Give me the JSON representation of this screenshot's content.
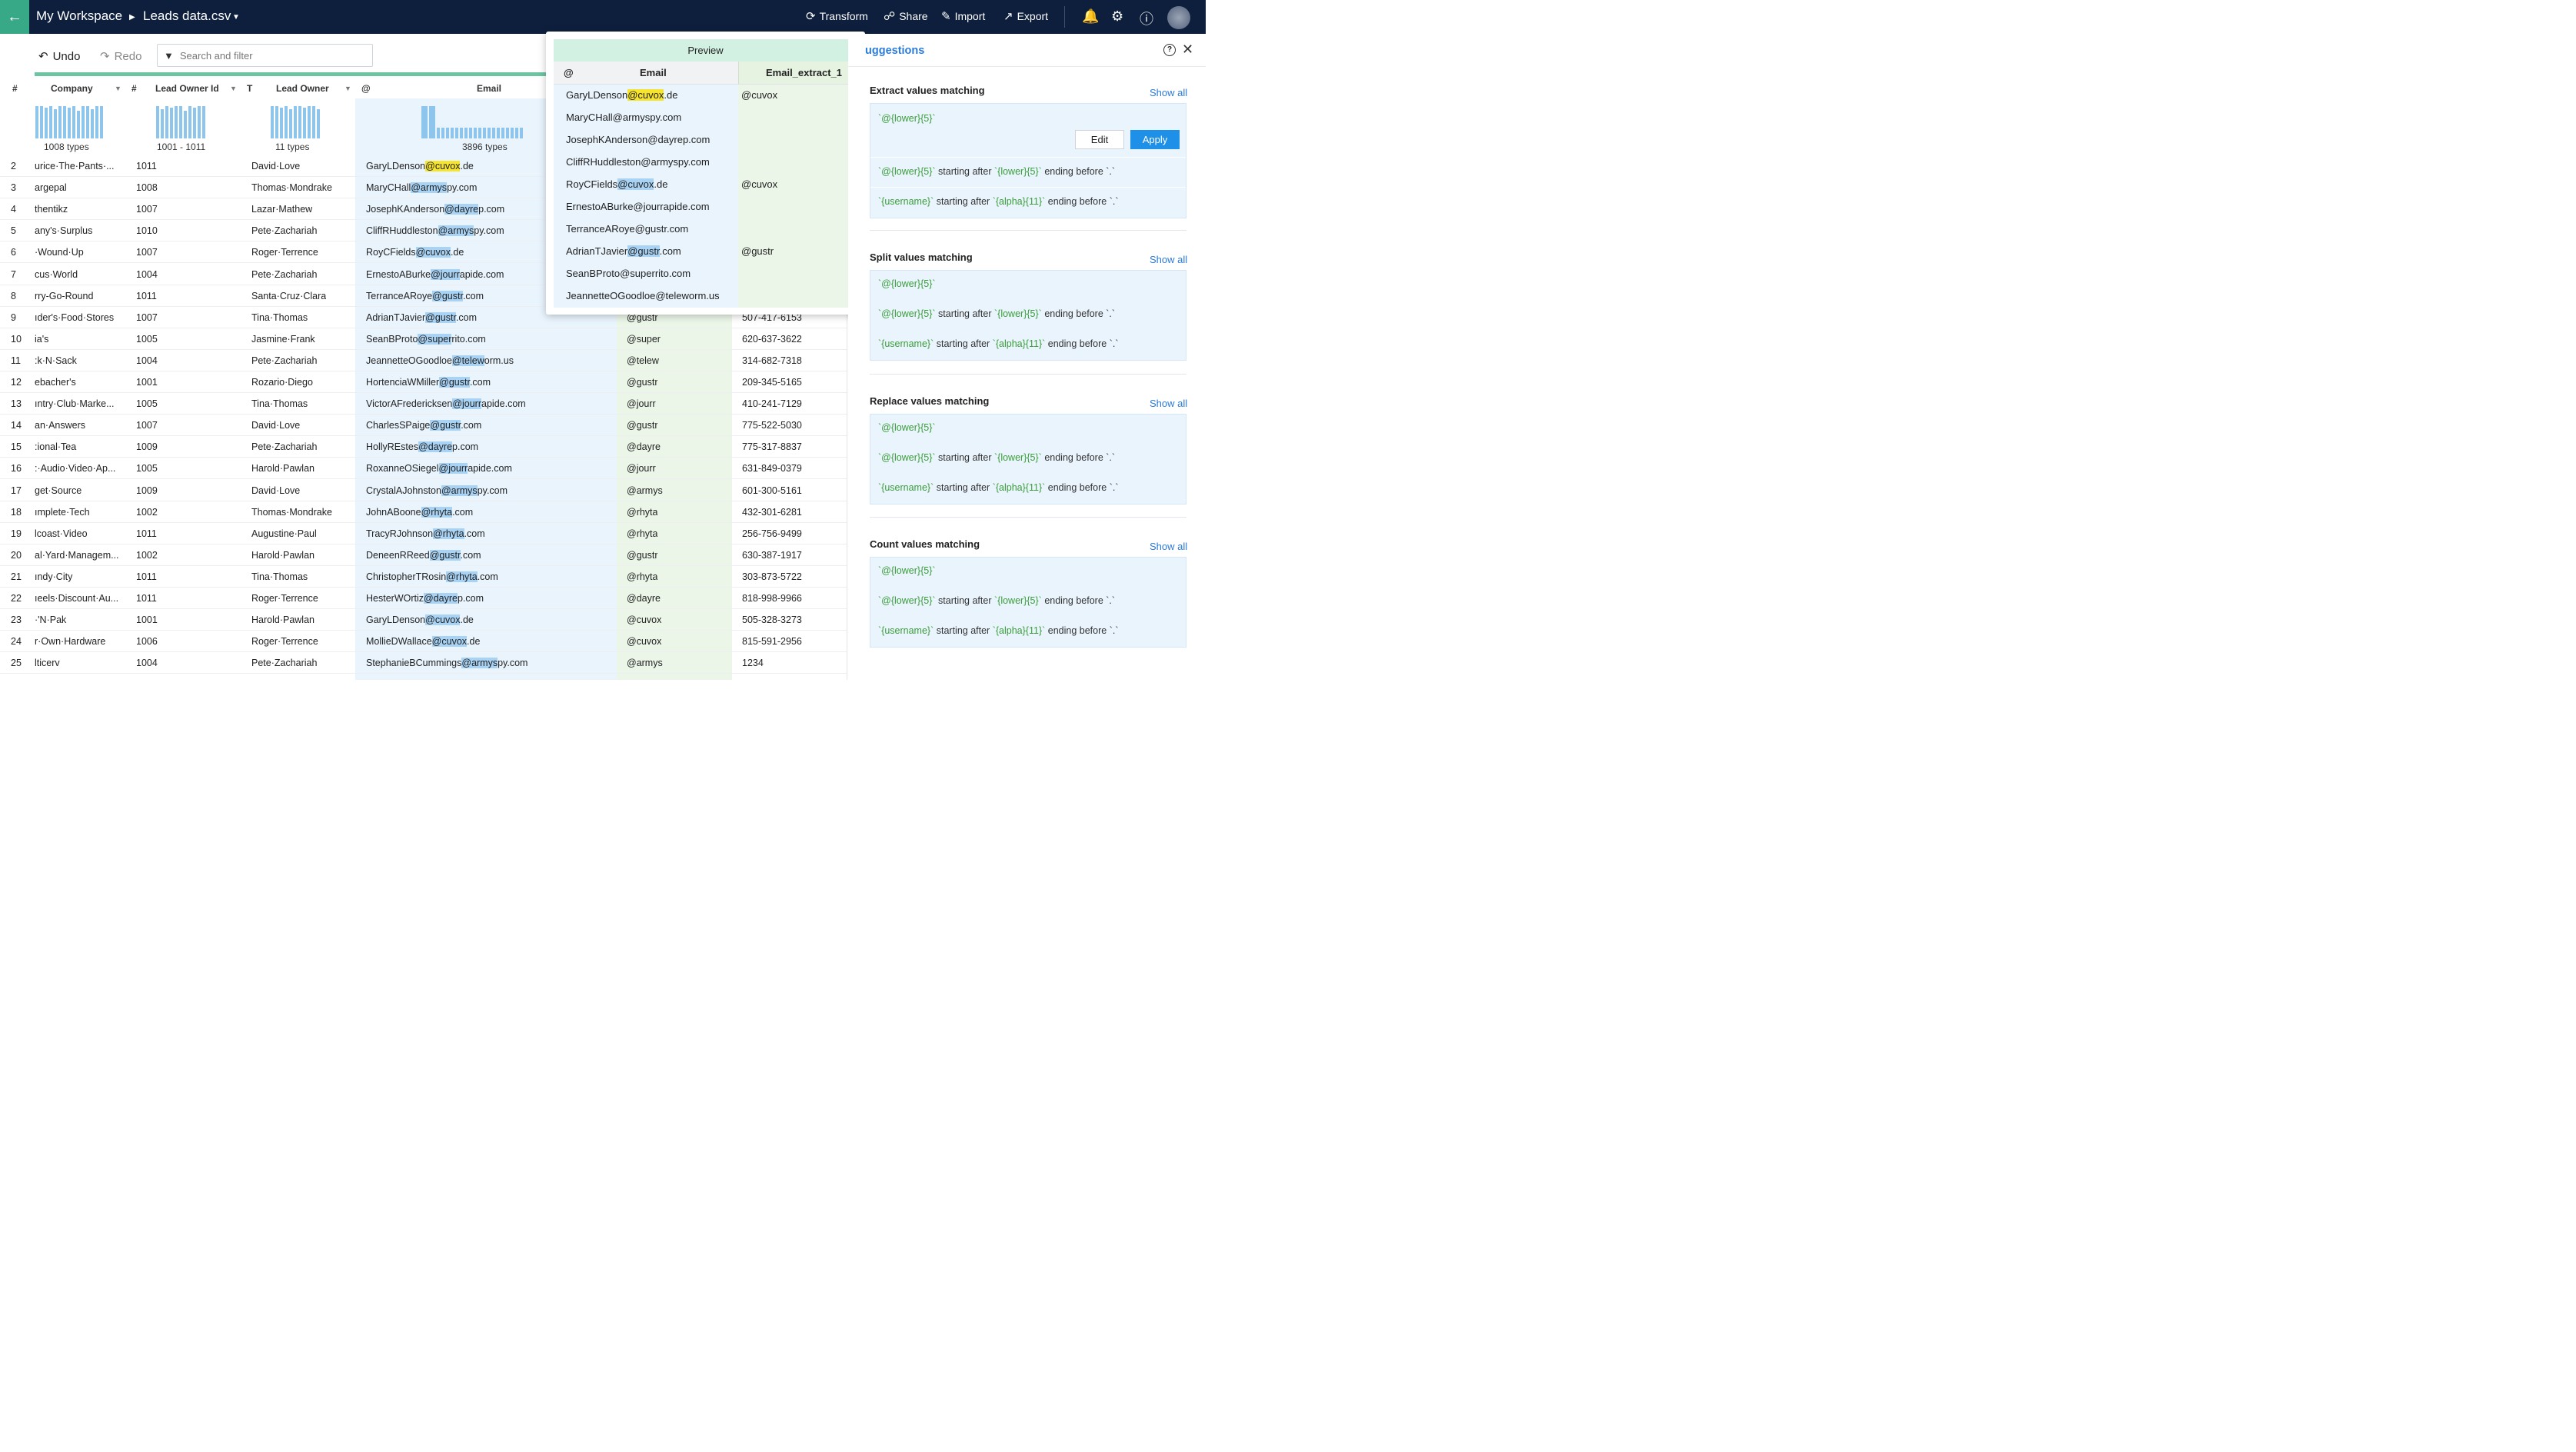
{
  "topbar": {
    "workspace": "My Workspace",
    "file": "Leads data.csv",
    "actions": [
      {
        "label": "Transform",
        "icon": "transform-icon"
      },
      {
        "label": "Share",
        "icon": "share-icon"
      },
      {
        "label": "Import",
        "icon": "import-icon"
      },
      {
        "label": "Export",
        "icon": "export-icon"
      }
    ]
  },
  "toolbar": {
    "undo": "Undo",
    "redo": "Redo",
    "search_placeholder": "Search and filter"
  },
  "columns": {
    "row_num": "#",
    "company": {
      "label": "Company",
      "types": "1008 types"
    },
    "lead_owner_id": {
      "type_icon": "#",
      "label": "Lead Owner Id",
      "types": "1001 - 1011"
    },
    "lead_owner": {
      "type_icon": "T",
      "label": "Lead Owner",
      "types": "11 types"
    },
    "email": {
      "type_icon": "@",
      "label": "Email",
      "types": "3896 types"
    }
  },
  "rows": [
    {
      "n": "2",
      "company": "urice·The·Pants·...",
      "id": "1011",
      "owner": "David·Love",
      "email_pre": "GaryLDenson",
      "email_hl": "@cuvox",
      "email_post": ".de",
      "ext": "",
      "phone": "",
      "yellow": true
    },
    {
      "n": "3",
      "company": "argepal",
      "id": "1008",
      "owner": "Thomas·Mondrake",
      "email_pre": "MaryCHall",
      "email_hl": "@armys",
      "email_post": "py.com",
      "ext": "",
      "phone": ""
    },
    {
      "n": "4",
      "company": "thentikz",
      "id": "1007",
      "owner": "Lazar·Mathew",
      "email_pre": "JosephKAnderson",
      "email_hl": "@dayre",
      "email_post": "p.com",
      "ext": "",
      "phone": ""
    },
    {
      "n": "5",
      "company": "any's·Surplus",
      "id": "1010",
      "owner": "Pete·Zachariah",
      "email_pre": "CliffRHuddleston",
      "email_hl": "@armys",
      "email_post": "py.com",
      "ext": "",
      "phone": ""
    },
    {
      "n": "6",
      "company": "·Wound·Up",
      "id": "1007",
      "owner": "Roger·Terrence",
      "email_pre": "RoyCFields",
      "email_hl": "@cuvox",
      "email_post": ".de",
      "ext": "",
      "phone": ""
    },
    {
      "n": "7",
      "company": "cus·World",
      "id": "1004",
      "owner": "Pete·Zachariah",
      "email_pre": "ErnestoABurke",
      "email_hl": "@jourr",
      "email_post": "apide.com",
      "ext": "",
      "phone": ""
    },
    {
      "n": "8",
      "company": "rry-Go-Round",
      "id": "1011",
      "owner": "Santa·Cruz·Clara",
      "email_pre": "TerranceARoye",
      "email_hl": "@gustr",
      "email_post": ".com",
      "ext": "",
      "phone": ""
    },
    {
      "n": "9",
      "company": "ıder's·Food·Stores",
      "id": "1007",
      "owner": "Tina·Thomas",
      "email_pre": "AdrianTJavier",
      "email_hl": "@gustr",
      "email_post": ".com",
      "ext": "@gustr",
      "phone": "507-417-6153"
    },
    {
      "n": "10",
      "company": "ia's",
      "id": "1005",
      "owner": "Jasmine·Frank",
      "email_pre": "SeanBProto",
      "email_hl": "@super",
      "email_post": "rito.com",
      "ext": "@super",
      "phone": "620-637-3622"
    },
    {
      "n": "11",
      "company": ":k·N·Sack",
      "id": "1004",
      "owner": "Pete·Zachariah",
      "email_pre": "JeannetteOGoodloe",
      "email_hl": "@telew",
      "email_post": "orm.us",
      "ext": "@telew",
      "phone": "314-682-7318"
    },
    {
      "n": "12",
      "company": "ebacher's",
      "id": "1001",
      "owner": "Rozario·Diego",
      "email_pre": "HortenciaWMiller",
      "email_hl": "@gustr",
      "email_post": ".com",
      "ext": "@gustr",
      "phone": "209-345-5165"
    },
    {
      "n": "13",
      "company": "ıntry·Club·Marke...",
      "id": "1005",
      "owner": "Tina·Thomas",
      "email_pre": "VictorAFredericksen",
      "email_hl": "@jourr",
      "email_post": "apide.com",
      "ext": "@jourr",
      "phone": "410-241-7129"
    },
    {
      "n": "14",
      "company": "an·Answers",
      "id": "1007",
      "owner": "David·Love",
      "email_pre": "CharlesSPaige",
      "email_hl": "@gustr",
      "email_post": ".com",
      "ext": "@gustr",
      "phone": "775-522-5030"
    },
    {
      "n": "15",
      "company": ":ional·Tea",
      "id": "1009",
      "owner": "Pete·Zachariah",
      "email_pre": "HollyREstes",
      "email_hl": "@dayre",
      "email_post": "p.com",
      "ext": "@dayre",
      "phone": "775-317-8837"
    },
    {
      "n": "16",
      "company": ":·Audio·Video·Ap...",
      "id": "1005",
      "owner": "Harold·Pawlan",
      "email_pre": "RoxanneOSiegel",
      "email_hl": "@jourr",
      "email_post": "apide.com",
      "ext": "@jourr",
      "phone": "631-849-0379"
    },
    {
      "n": "17",
      "company": "get·Source",
      "id": "1009",
      "owner": "David·Love",
      "email_pre": "CrystalAJohnston",
      "email_hl": "@armys",
      "email_post": "py.com",
      "ext": "@armys",
      "phone": "601-300-5161"
    },
    {
      "n": "18",
      "company": "ımplete·Tech",
      "id": "1002",
      "owner": "Thomas·Mondrake",
      "email_pre": "JohnABoone",
      "email_hl": "@rhyta",
      "email_post": ".com",
      "ext": "@rhyta",
      "phone": "432-301-6281"
    },
    {
      "n": "19",
      "company": "lcoast·Video",
      "id": "1011",
      "owner": "Augustine·Paul",
      "email_pre": "TracyRJohnson",
      "email_hl": "@rhyta",
      "email_post": ".com",
      "ext": "@rhyta",
      "phone": "256-756-9499"
    },
    {
      "n": "20",
      "company": "al·Yard·Managem...",
      "id": "1002",
      "owner": "Harold·Pawlan",
      "email_pre": "DeneenRReed",
      "email_hl": "@gustr",
      "email_post": ".com",
      "ext": "@gustr",
      "phone": "630-387-1917"
    },
    {
      "n": "21",
      "company": "ındy·City",
      "id": "1011",
      "owner": "Tina·Thomas",
      "email_pre": "ChristopherTRosin",
      "email_hl": "@rhyta",
      "email_post": ".com",
      "ext": "@rhyta",
      "phone": "303-873-5722"
    },
    {
      "n": "22",
      "company": "ıeels·Discount·Au...",
      "id": "1011",
      "owner": "Roger·Terrence",
      "email_pre": "HesterWOrtiz",
      "email_hl": "@dayre",
      "email_post": "p.com",
      "ext": "@dayre",
      "phone": "818-998-9966"
    },
    {
      "n": "23",
      "company": "·'N·Pak",
      "id": "1001",
      "owner": "Harold·Pawlan",
      "email_pre": "GaryLDenson",
      "email_hl": "@cuvox",
      "email_post": ".de",
      "ext": "@cuvox",
      "phone": "505-328-3273"
    },
    {
      "n": "24",
      "company": "r·Own·Hardware",
      "id": "1006",
      "owner": "Roger·Terrence",
      "email_pre": "MollieDWallace",
      "email_hl": "@cuvox",
      "email_post": ".de",
      "ext": "@cuvox",
      "phone": "815-591-2956"
    },
    {
      "n": "25",
      "company": "lticerv",
      "id": "1004",
      "owner": "Pete·Zachariah",
      "email_pre": "StephanieBCummings",
      "email_hl": "@armys",
      "email_post": "py.com",
      "ext": "@armys",
      "phone": "1234"
    }
  ],
  "preview": {
    "title": "Preview",
    "col1_icon": "@",
    "col1": "Email",
    "col2": "Email_extract_1",
    "rows": [
      {
        "pre": "GaryLDenson",
        "hl": "@cuvox",
        "post": ".de",
        "ext": "@cuvox",
        "yellow": true
      },
      {
        "pre": "MaryCHall@armyspy.com",
        "hl": "",
        "post": "",
        "ext": ""
      },
      {
        "pre": "JosephKAnderson@dayrep.com",
        "hl": "",
        "post": "",
        "ext": ""
      },
      {
        "pre": "CliffRHuddleston@armyspy.com",
        "hl": "",
        "post": "",
        "ext": ""
      },
      {
        "pre": "RoyCFields",
        "hl": "@cuvox",
        "post": ".de",
        "ext": "@cuvox"
      },
      {
        "pre": "ErnestoABurke@jourrapide.com",
        "hl": "",
        "post": "",
        "ext": ""
      },
      {
        "pre": "TerranceARoye@gustr.com",
        "hl": "",
        "post": "",
        "ext": ""
      },
      {
        "pre": "AdrianTJavier",
        "hl": "@gustr",
        "post": ".com",
        "ext": "@gustr"
      },
      {
        "pre": "SeanBProto@superrito.com",
        "hl": "",
        "post": "",
        "ext": ""
      },
      {
        "pre": "JeannetteOGoodloe@teleworm.us",
        "hl": "",
        "post": "",
        "ext": ""
      }
    ]
  },
  "panel": {
    "title": "uggestions",
    "show_all": "Show all",
    "sections": [
      {
        "title": "Extract values matching",
        "edit": "Edit",
        "apply": "Apply"
      },
      {
        "title": "Split values matching"
      },
      {
        "title": "Replace values matching"
      },
      {
        "title": "Count values matching"
      }
    ],
    "pattern_a": "`@{lower}{5}`",
    "pattern_b_start": "`@{lower}{5}`",
    "pattern_b_mid1": " starting after ",
    "pattern_b_val1": "`{lower}{5}`",
    "pattern_b_mid2": " ending before ",
    "pattern_b_val2": "`.`",
    "pattern_c_start": "`{username}`",
    "pattern_c_val1": "`{alpha}{11}`"
  }
}
